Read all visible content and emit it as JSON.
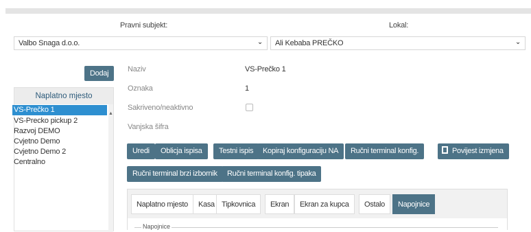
{
  "filters": {
    "pravni_subjekt_label": "Pravni subjekt:",
    "pravni_subjekt_value": "Valbo Snaga d.o.o.",
    "lokal_label": "Lokal:",
    "lokal_value": "Ali Kebaba PREČKO"
  },
  "list": {
    "add_label": "Dodaj",
    "header": "Naplatno mjesto",
    "items": [
      "VS-Prečko 1",
      "VS-Precko pickup 2",
      "Razvoj DEMO",
      "Cvjetno Demo",
      "Cvjetno Demo 2",
      "Centralno"
    ],
    "selected_index": 0
  },
  "details": {
    "naziv_label": "Naziv",
    "naziv_value": "VS-Prečko 1",
    "oznaka_label": "Oznaka",
    "oznaka_value": "1",
    "sakriveno_label": "Sakriveno/neaktivno",
    "sakriveno_checked": false,
    "vanjska_label": "Vanjska šifra",
    "vanjska_value": ""
  },
  "actions": {
    "uredi": "Uredi",
    "oblicja": "Oblicja ispisa",
    "testni": "Testni ispis",
    "kopiraj": "Kopiraj konfiguraciju NA",
    "rucni_konfig": "Ručni terminal konfig.",
    "povijest": "Povijest izmjena",
    "rucni_brzi": "Ručni terminal brzi izbornik",
    "rucni_tipaka": "Ručni terminal konfig. tipaka"
  },
  "tabs": [
    "Naplatno mjesto",
    "Kasa",
    "Tipkovnica",
    "Ekran",
    "Ekran za kupca",
    "Ostalo",
    "Napojnice"
  ],
  "active_tab": "Napojnice",
  "section_legend": "Napojnice",
  "colors": {
    "button": "#4d7387",
    "selected": "#2e8fd0",
    "header_text": "#2c5a7a"
  }
}
